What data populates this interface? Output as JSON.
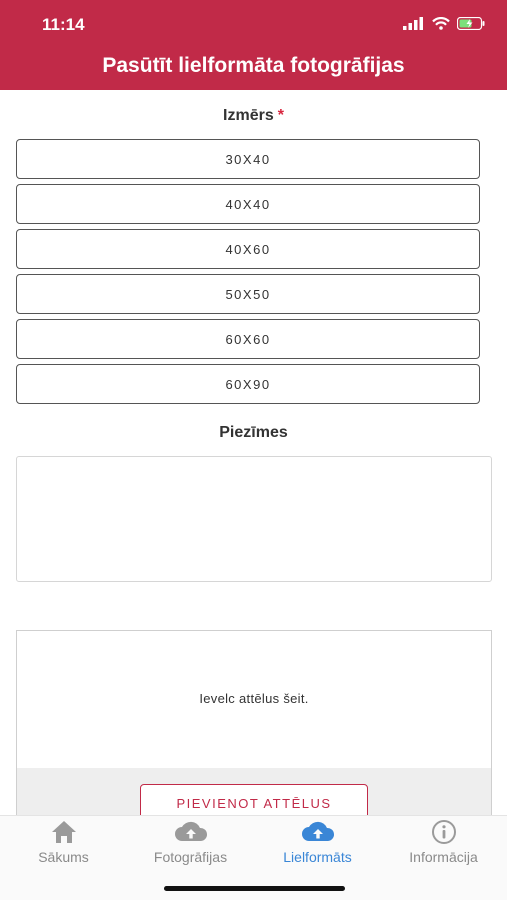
{
  "status_bar": {
    "time": "11:14"
  },
  "header": {
    "title": "Pasūtīt lielformāta fotogrāfijas"
  },
  "size_section": {
    "label": "Izmērs",
    "required_mark": "*",
    "options": [
      "30X40",
      "40X40",
      "40X60",
      "50X50",
      "60X60",
      "60X90"
    ]
  },
  "notes_section": {
    "label": "Piezīmes",
    "value": ""
  },
  "upload": {
    "hint": "Ievelc attēlus šeit.",
    "button_label": "PIEVIENOT ATTĒLUS"
  },
  "tab_bar": {
    "tabs": [
      {
        "label": "Sākums",
        "icon": "home-icon"
      },
      {
        "label": "Fotogrāfijas",
        "icon": "cloud-upload-icon"
      },
      {
        "label": "Lielformāts",
        "icon": "cloud-upload-icon"
      },
      {
        "label": "Informācija",
        "icon": "info-icon"
      }
    ],
    "active_tab": "Lielformāts"
  },
  "colors": {
    "brand": "#c12a48",
    "active_tab": "#3a86d6",
    "inactive_tab": "#8a8a8a"
  }
}
